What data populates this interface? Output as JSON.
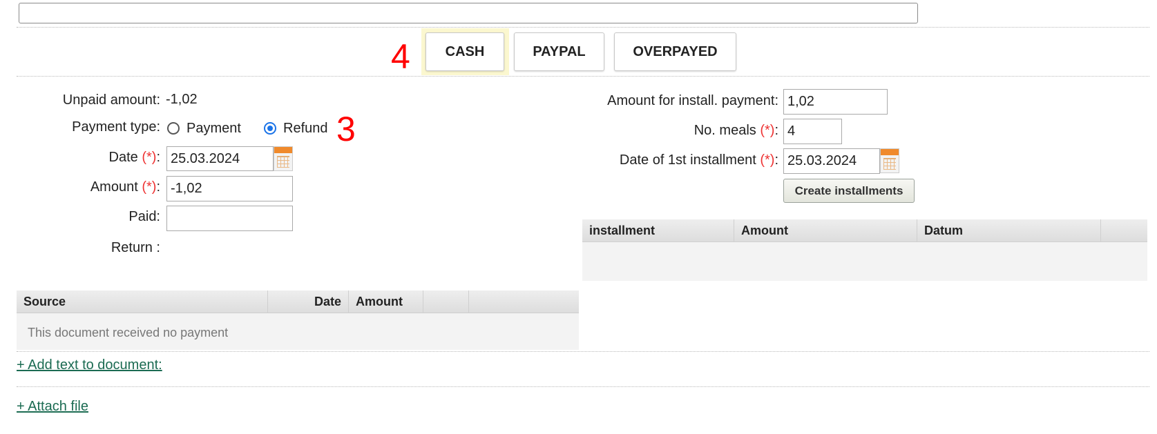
{
  "annotations": {
    "cash_marker": "4",
    "refund_marker": "3"
  },
  "tabs": [
    {
      "label": "CASH"
    },
    {
      "label": "PAYPAL"
    },
    {
      "label": "OVERPAYED"
    }
  ],
  "left_form": {
    "unpaid_label": "Unpaid amount:",
    "unpaid_value": "-1,02",
    "payment_type_label": "Payment type:",
    "option_payment": "Payment",
    "option_refund": "Refund",
    "selected_option": "Refund",
    "date_label": "Date",
    "date_required": "(*)",
    "date_value": "25.03.2024",
    "amount_label": "Amount",
    "amount_required": "(*)",
    "amount_value": "-1,02",
    "paid_label": "Paid:",
    "paid_value": "",
    "return_label": "Return :"
  },
  "right_form": {
    "install_amount_label": "Amount for install. payment:",
    "install_amount_value": "1,02",
    "meals_label": "No. meals",
    "meals_required": "(*)",
    "meals_value": "4",
    "first_install_label": "Date of 1st installment",
    "first_install_required": "(*)",
    "first_install_value": "25.03.2024",
    "create_button": "Create installments"
  },
  "installments_table": {
    "columns": [
      "installment",
      "Amount",
      "Datum"
    ],
    "rows": []
  },
  "payments_table": {
    "columns": [
      "Source",
      "Date",
      "Amount"
    ],
    "rows": [],
    "empty_message": "This document received no payment"
  },
  "links": {
    "add_text": "+ Add text to document:",
    "attach_file": "+ Attach file"
  },
  "colors": {
    "required": "#ee3333",
    "link": "#1b6b52",
    "radio_selected": "#1a73e8",
    "annotation": "#ff0000"
  }
}
